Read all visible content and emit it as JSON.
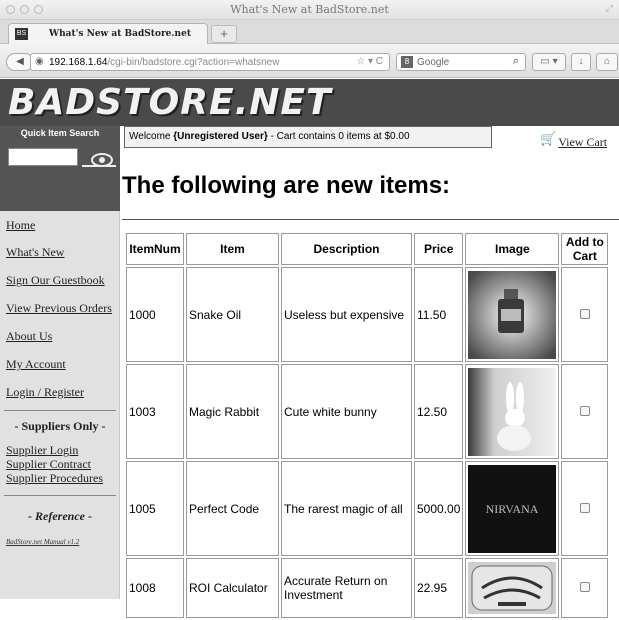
{
  "window": {
    "title": "What's New at BadStore.net",
    "tab_title": "What's New at BadStore.net",
    "tab_icon_label": "BS",
    "new_tab_label": "+"
  },
  "navbar": {
    "back_label": "◀",
    "url_host": "192.168.1.64",
    "url_path": "/cgi-bin/badstore.cgi?action=whatsnew",
    "search_placeholder": "Google",
    "search_engine_icon": "8"
  },
  "site": {
    "logo": "BADSTORE.NET",
    "quick_search_label": "Quick Item Search",
    "quick_search_value": "",
    "welcome": {
      "prefix": "Welcome ",
      "user": "{Unregistered User}",
      "suffix": " - Cart contains 0 items at $0.00"
    },
    "view_cart": "View Cart"
  },
  "sidebar": {
    "links": [
      "Home",
      "What's New",
      "Sign Our Guestbook",
      "View Previous Orders",
      "About Us",
      "My Account",
      "Login / Register"
    ],
    "suppliers_heading": "- Suppliers Only -",
    "supplier_links": [
      "Supplier Login",
      "Supplier Contract",
      "Supplier Procedures"
    ],
    "reference_heading": "- Reference -",
    "manual_link": "BadStore.net Manual v1.2"
  },
  "main": {
    "heading": "The following are new items:",
    "columns": [
      "ItemNum",
      "Item",
      "Description",
      "Price",
      "Image",
      "Add to Cart"
    ],
    "rows": [
      {
        "num": "1000",
        "item": "Snake Oil",
        "description": "Useless but expensive",
        "price": "11.50",
        "image_label": "",
        "image": "snake-oil-bottle"
      },
      {
        "num": "1003",
        "item": "Magic Rabbit",
        "description": "Cute white bunny",
        "price": "12.50",
        "image_label": "",
        "image": "white-rabbit"
      },
      {
        "num": "1005",
        "item": "Perfect Code",
        "description": "The rarest magic of all",
        "price": "5000.00",
        "image_label": "NIRVANA",
        "image": "nirvana-album"
      },
      {
        "num": "1008",
        "item": "ROI Calculator",
        "description": "Accurate Return on Investment",
        "price": "22.95",
        "image_label": "",
        "image": "ouija-board"
      }
    ]
  },
  "icons": {
    "globe": "globe-icon",
    "search": "search-icon",
    "cart": "shopping-cart-icon"
  }
}
